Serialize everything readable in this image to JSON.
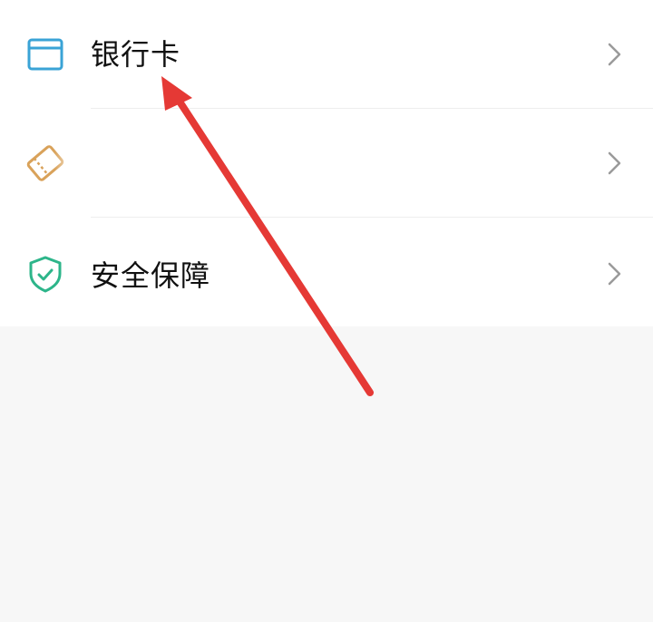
{
  "menu": {
    "items": [
      {
        "label": "银行卡",
        "icon": "bank-card-icon",
        "icon_color": "#3aa3d6"
      },
      {
        "label": "",
        "icon": "coupon-icon",
        "icon_color": "#d9a25a"
      },
      {
        "label": "安全保障",
        "icon": "shield-check-icon",
        "icon_color": "#2db58a"
      }
    ],
    "chevron_icon": "chevron-right-icon"
  },
  "annotation": {
    "arrow_icon": "red-arrow-icon",
    "arrow_color": "#e53935"
  },
  "colors": {
    "page_background": "#f7f7f7",
    "card_background": "#ffffff",
    "divider": "#eeeeee",
    "chevron": "#9a9a9a"
  }
}
